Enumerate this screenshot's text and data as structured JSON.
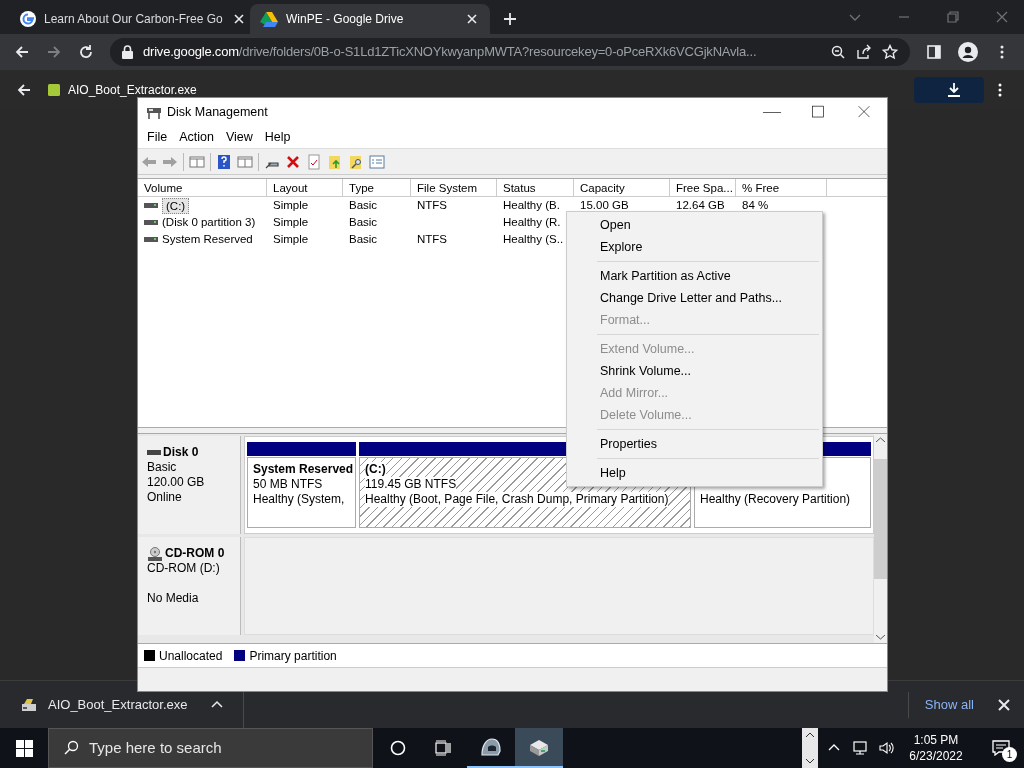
{
  "browser": {
    "tabs": [
      {
        "title": "Learn About Our Carbon-Free Go",
        "kind": "google",
        "selected": false
      },
      {
        "title": "WinPE - Google Drive",
        "kind": "drive",
        "selected": true
      }
    ],
    "address": {
      "host": "drive.google.com",
      "path": "/drive/folders/0B-o-S1Ld1ZTicXNOYkwyanpMWTA?resourcekey=0-oPceRXk6VCGjkNAvla..."
    }
  },
  "preview": {
    "file_name": "AIO_Boot_Extractor.exe"
  },
  "window": {
    "title": "Disk Management",
    "menu": [
      "File",
      "Action",
      "View",
      "Help"
    ],
    "columns": [
      "Volume",
      "Layout",
      "Type",
      "File System",
      "Status",
      "Capacity",
      "Free Spa...",
      "% Free"
    ],
    "rows": [
      {
        "cells": [
          "(C:)",
          "Simple",
          "Basic",
          "NTFS",
          "Healthy (B.",
          "15.00 GB",
          "12.64 GB",
          "84 %"
        ],
        "selected": true
      },
      {
        "cells": [
          "(Disk 0 partition 3)",
          "Simple",
          "Basic",
          "",
          "Healthy (R."
        ],
        "selected": false
      },
      {
        "cells": [
          "System Reserved",
          "Simple",
          "Basic",
          "NTFS",
          "Healthy (S.."
        ],
        "selected": false
      }
    ],
    "disks": [
      {
        "name": "Disk 0",
        "kind": "disk",
        "lines": [
          "Basic",
          "120.00 GB",
          "Online"
        ],
        "partitions": [
          {
            "name": "System Reserved",
            "size": "50 MB NTFS",
            "status": "Healthy (System,",
            "selected": false
          },
          {
            "name": "(C:)",
            "size": "119.45 GB NTFS",
            "status": "Healthy (Boot, Page File, Crash Dump, Primary Partition)",
            "selected": true
          },
          {
            "status": "Healthy (Recovery Partition)",
            "selected": false
          }
        ]
      },
      {
        "name": "CD-ROM 0",
        "kind": "cdrom",
        "lines": [
          "CD-ROM (D:)",
          "No Media"
        ]
      }
    ],
    "legend": [
      {
        "label": "Unallocated",
        "color": "#000000"
      },
      {
        "label": "Primary partition",
        "color": "#000080"
      }
    ]
  },
  "context_menu": [
    {
      "kind": "item",
      "label": "Open",
      "disabled": false
    },
    {
      "kind": "item",
      "label": "Explore",
      "disabled": false
    },
    {
      "kind": "separator"
    },
    {
      "kind": "item",
      "label": "Mark Partition as Active",
      "disabled": false
    },
    {
      "kind": "item",
      "label": "Change Drive Letter and Paths...",
      "disabled": false
    },
    {
      "kind": "item",
      "label": "Format...",
      "disabled": true
    },
    {
      "kind": "separator"
    },
    {
      "kind": "item",
      "label": "Extend Volume...",
      "disabled": true
    },
    {
      "kind": "item",
      "label": "Shrink Volume...",
      "disabled": false
    },
    {
      "kind": "item",
      "label": "Add Mirror...",
      "disabled": true
    },
    {
      "kind": "item",
      "label": "Delete Volume...",
      "disabled": true
    },
    {
      "kind": "separator"
    },
    {
      "kind": "item",
      "label": "Properties",
      "disabled": false
    },
    {
      "kind": "separator"
    },
    {
      "kind": "item",
      "label": "Help",
      "disabled": false
    }
  ],
  "download_bar": {
    "file_name": "AIO_Boot_Extractor.exe",
    "show_all": "Show all"
  },
  "taskbar": {
    "search_placeholder": "Type here to search",
    "apps": [
      {
        "kind": "helmet",
        "selected": false
      },
      {
        "kind": "disk-tool",
        "selected": true
      }
    ],
    "time": "1:05 PM",
    "date": "6/23/2022",
    "notifications": "1"
  }
}
